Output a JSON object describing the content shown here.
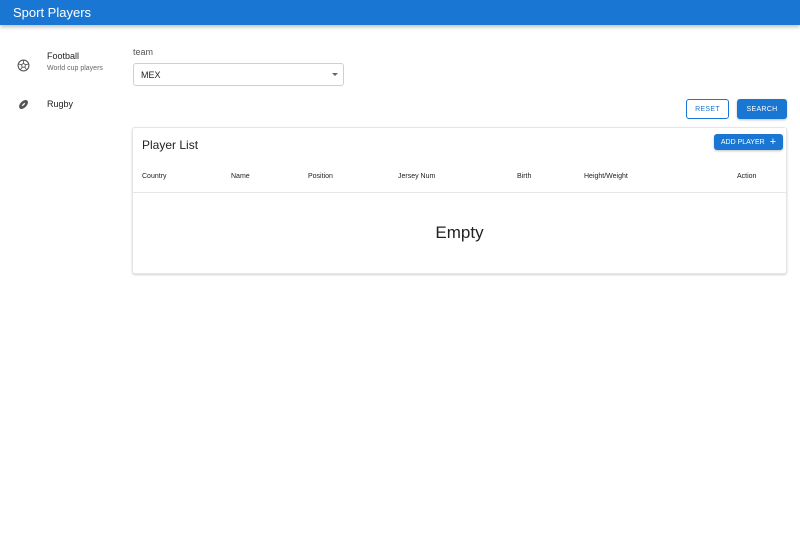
{
  "app": {
    "title": "Sport Players"
  },
  "sidebar": {
    "items": [
      {
        "icon": "soccer-ball-icon",
        "label": "Football",
        "subtitle": "World cup players"
      },
      {
        "icon": "football-icon",
        "label": "Rugby"
      }
    ]
  },
  "filter": {
    "team_label": "team",
    "team_value": "MEX",
    "reset_label": "RESET",
    "search_label": "SEARCH"
  },
  "player_list": {
    "title": "Player List",
    "add_label": "ADD PLAYER",
    "columns": [
      "Country",
      "Name",
      "Position",
      "Jersey Num",
      "Birth",
      "Height/Weight",
      "Action"
    ],
    "empty_text": "Empty"
  },
  "colors": {
    "primary": "#1976d2"
  }
}
